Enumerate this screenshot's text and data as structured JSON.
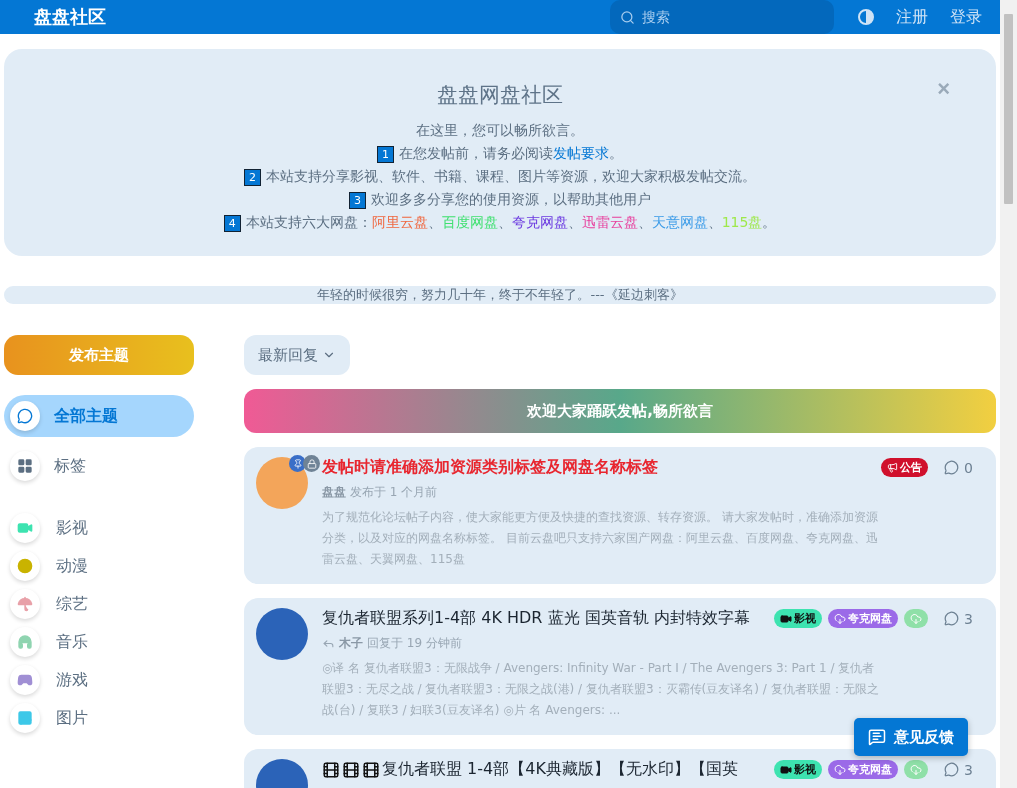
{
  "header": {
    "logo": "盘盘社区",
    "search": {
      "placeholder": "搜索"
    },
    "links": [
      "注册",
      "登录"
    ]
  },
  "notice": {
    "title": "盘盘网盘社区",
    "close": "×",
    "intro": "在这里，您可以畅所欲言。",
    "items": [
      {
        "num": "1",
        "text": "在您发帖前，请务必阅读",
        "link": "发帖要求",
        "tail": "。"
      },
      {
        "num": "2",
        "text": "本站支持分享影视、软件、书籍、课程、图片等资源，欢迎大家积极发帖交流。"
      },
      {
        "num": "3",
        "text": "欢迎多多分享您的使用资源，以帮助其他用户"
      },
      {
        "num": "4",
        "text": "本站支持六大网盘：",
        "disks": [
          {
            "name": "阿里云盘",
            "color": "#f0663e",
            "sep": "、"
          },
          {
            "name": "百度网盘",
            "color": "#3fe070",
            "sep": "、"
          },
          {
            "name": "夸克网盘",
            "color": "#6a38e0",
            "sep": "、"
          },
          {
            "name": "迅雷云盘",
            "color": "#e83d9c",
            "sep": "、"
          },
          {
            "name": "天意网盘",
            "color": "#3d9ce8",
            "sep": "、"
          },
          {
            "name": "115盘",
            "color": "#9ee84a"
          }
        ],
        "tail": "。"
      }
    ]
  },
  "quote": "年轻的时候很穷，努力几十年，终于不年轻了。---《延边刺客》",
  "sidebar": {
    "post_button": "发布主题",
    "nav": [
      {
        "label": "全部主题",
        "selected": true
      },
      {
        "label": "标签",
        "selected": false
      }
    ],
    "categories": [
      {
        "label": "影视",
        "color": "#3de3b0"
      },
      {
        "label": "动漫",
        "color": "#c9b300"
      },
      {
        "label": "综艺",
        "color": "#e8a0a8"
      },
      {
        "label": "音乐",
        "color": "#8fd4b0"
      },
      {
        "label": "游戏",
        "color": "#a08fd4"
      },
      {
        "label": "图片",
        "color": "#3dc8e8"
      }
    ]
  },
  "sort": {
    "label": "最新回复"
  },
  "banner": "欢迎大家踊跃发帖,畅所欲言",
  "posts": [
    {
      "title": "发帖时请准确添加资源类别标签及网盘名称标签",
      "pinned": true,
      "locked": true,
      "author": "盘盘",
      "action": "发布于 1 个月前",
      "replied": false,
      "badges": [
        {
          "label": "公告",
          "color": "#d0102c"
        }
      ],
      "comments": "0",
      "excerpt": "为了规范化论坛帖子内容，使大家能更方便及快捷的查找资源、转存资源。 请大家发帖时，准确添加资源分类，以及对应的网盘名称标签。 目前云盘吧只支持六家国产网盘：阿里云盘、百度网盘、夸克网盘、迅雷云盘、天翼网盘、115盘"
    },
    {
      "title": "复仇者联盟系列1-4部 4K HDR 蓝光 国英音轨 内封特效字幕",
      "pinned": false,
      "locked": false,
      "author": "木子",
      "action": "回复于 19 分钟前",
      "replied": true,
      "badges": [
        {
          "label": "影视",
          "color": "#3de3b0"
        },
        {
          "label": "夸克网盘",
          "color": "#9b6ae8"
        },
        {
          "color": "#8fe0a8"
        }
      ],
      "comments": "3",
      "excerpt": "◎译 名 复仇者联盟3：无限战争 / Avengers: Infinity War - Part I / The Avengers 3: Part 1 / 复仇者联盟3：无尽之战 / 复仇者联盟3：无限之战(港) / 复仇者联盟3：灭霸传(豆友译名) / 复仇者联盟：无限之战(台) / 复联3 / 妇联3(豆友译名) ◎片 名 Avengers: ..."
    },
    {
      "title": "复仇者联盟 1-4部【4K典藏版】【无水印】【国英",
      "pinned": false,
      "locked": false,
      "replied": false,
      "badges": [
        {
          "label": "影视",
          "color": "#3de3b0"
        },
        {
          "label": "夸克网盘",
          "color": "#9b6ae8"
        },
        {
          "color": "#8fe0a8"
        }
      ],
      "comments": "3"
    }
  ],
  "feedback": "意见反馈"
}
